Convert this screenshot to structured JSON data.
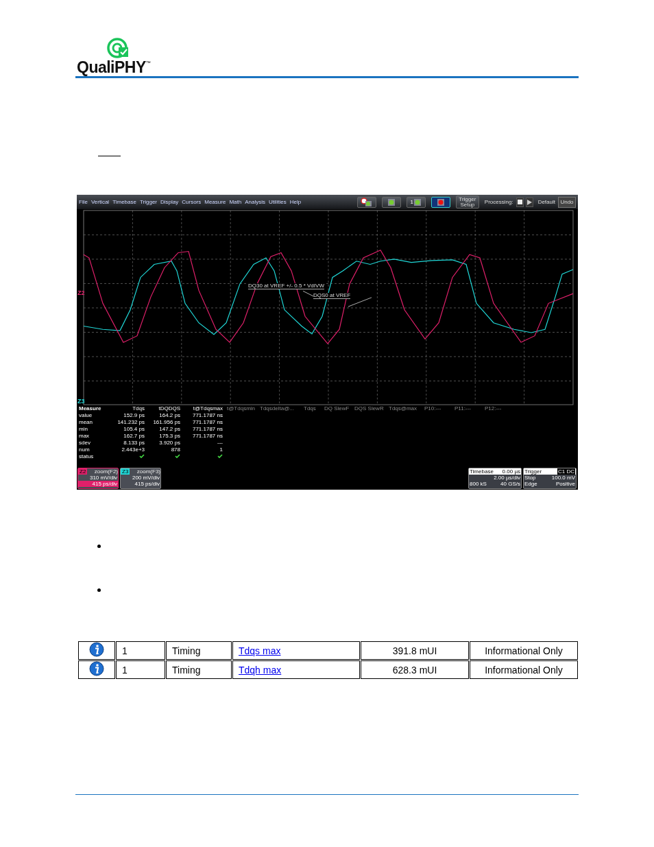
{
  "header": {
    "logo_text": "QualiPHY",
    "trademark": "™"
  },
  "scope": {
    "menu": [
      "File",
      "Vertical",
      "Timebase",
      "Trigger",
      "Display",
      "Cursors",
      "Measure",
      "Math",
      "Analysis",
      "Utilities",
      "Help"
    ],
    "toolbar": {
      "trigger_setup": [
        "Trigger",
        "Setup"
      ],
      "processing": "Processing:",
      "default": "Default",
      "undo": "Undo",
      "channel_number": "1"
    },
    "grid": {
      "trace_labels": [
        {
          "text": "Z2",
          "color": "#e0206a"
        },
        {
          "text": "Z3",
          "color": "#20d8d8"
        }
      ],
      "annotations": [
        "DQ30 at VREF +/- 0.5 * VdIVW",
        "DQS0 at VREF"
      ]
    },
    "measure": {
      "header": [
        "Measure",
        "Tdqs",
        "tDQDQS",
        "t@Tdqsmax",
        "t@Tdqsmin",
        "Tdqsdelta@...",
        "Tdqs",
        "DQ SlewF",
        "DQS SlewR",
        "Tdqs@max",
        "P10:---",
        "P11:---",
        "P12:---"
      ],
      "rows": [
        {
          "label": "value",
          "cells": [
            "152.9 ps",
            "164.2 ps",
            "771.1787 ns"
          ]
        },
        {
          "label": "mean",
          "cells": [
            "141.232 ps",
            "161.956 ps",
            "771.1787 ns"
          ]
        },
        {
          "label": "min",
          "cells": [
            "105.4 ps",
            "147.2 ps",
            "771.1787 ns"
          ]
        },
        {
          "label": "max",
          "cells": [
            "162.7 ps",
            "175.3 ps",
            "771.1787 ns"
          ]
        },
        {
          "label": "sdev",
          "cells": [
            "8.133 ps",
            "3.920 ps",
            "---"
          ]
        },
        {
          "label": "num",
          "cells": [
            "2.443e+3",
            "878",
            "1"
          ]
        }
      ],
      "status_label": "status"
    },
    "zooms": [
      {
        "tag": "Z2",
        "title": "zoom(F2)",
        "vdiv": "310 mV/div",
        "tdiv": "415 ps/div",
        "color": "#e0206a",
        "selected": true
      },
      {
        "tag": "Z3",
        "title": "zoom(F3)",
        "vdiv": "200 mV/div",
        "tdiv": "415 ps/div",
        "color": "#20d8d8",
        "selected": false
      }
    ],
    "timebase": {
      "title": "Timebase",
      "delay": "0.00 µs",
      "tdiv": "2.00 µs/div",
      "samples": "800 kS",
      "rate": "40 GS/s"
    },
    "trigger": {
      "title": "Trigger",
      "badge": "C1 DC",
      "mode": "Stop",
      "level": "100.0 mV",
      "type": "Edge",
      "slope": "Positive"
    }
  },
  "results": [
    {
      "number": "1",
      "category": "Timing",
      "test": "Tdqs max",
      "value": "391.8 mUI",
      "status": "Informational Only"
    },
    {
      "number": "1",
      "category": "Timing",
      "test": "Tdqh max",
      "value": "628.3 mUI",
      "status": "Informational Only"
    }
  ]
}
